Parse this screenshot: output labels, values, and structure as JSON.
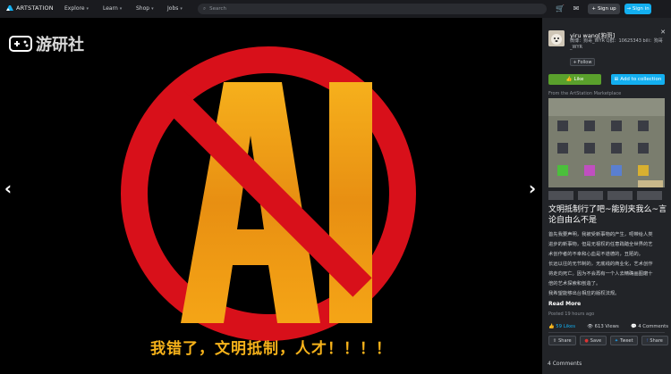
{
  "topbar": {
    "logo_text": "ARTSTATION",
    "nav": [
      {
        "label": "Explore"
      },
      {
        "label": "Learn"
      },
      {
        "label": "Shop"
      },
      {
        "label": "Jobs"
      }
    ],
    "search_placeholder": "Search",
    "sign_up": "Sign up",
    "sign_in": "Sign in"
  },
  "watermark": {
    "text": "游研社"
  },
  "artwork": {
    "letters": "AI"
  },
  "caption": "我错了，文明抵制，人才！！！！",
  "panel": {
    "username": "yiru wang[狗哥]",
    "headline": "微博：狗哥_WYR Q群：10625343 bili：狗哥_WYR",
    "follow": "Follow",
    "like": "Like",
    "add_collection": "Add to collection",
    "marketplace_label": "From the ArtStation Marketplace",
    "title": "文明抵制行了吧~能别夹我么~言论自由么不是",
    "description_lines": [
      "首先我要声明，我被受新事物的产生，呃带给人类",
      "进步的新事物，但是无视权的任意践踏全世界的艺",
      "术创作者的不幸和心血是不道德的，丑陋的。",
      "长远以往的无节制的，无底线的商业化，艺术创作",
      "将走向死亡。因为不会再有一个人去精确画图磨十",
      "倍的艺术探索和刨造了。",
      "我希望能够出台相应的版权法规。",
      "起到我们的呼吁们 是不是可以我们自己先自愿起"
    ],
    "read_more": "Read More",
    "posted": "Posted 19 hours ago",
    "likes": "59 Likes",
    "views": "613 Views",
    "comments_count": "4 Comments",
    "share_buttons": [
      {
        "label": "Share",
        "icon": "share-icon"
      },
      {
        "label": "Save",
        "icon": "save-icon"
      },
      {
        "label": "Tweet",
        "icon": "twitter-icon"
      },
      {
        "label": "Share",
        "icon": "facebook-icon"
      }
    ],
    "comments_heading": "4 Comments"
  },
  "colors": {
    "accent": "#13aff0",
    "like_green": "#5aa02c",
    "prohibit_red": "#d8101a",
    "ai_gold": "#f5a516",
    "caption": "#f6b21a"
  }
}
